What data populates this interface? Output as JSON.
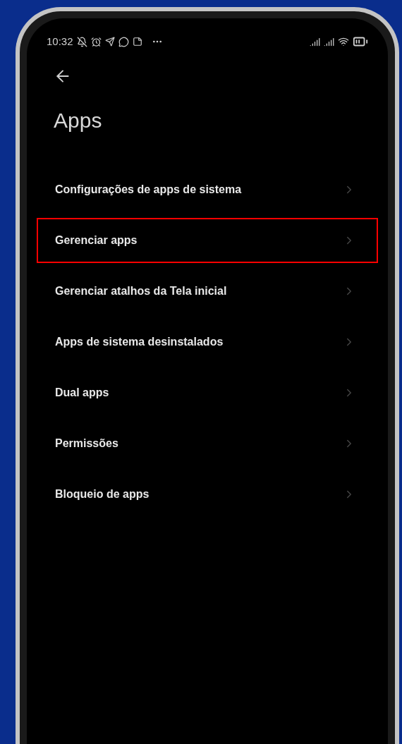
{
  "status_bar": {
    "time": "10:32"
  },
  "title": "Apps",
  "items": [
    {
      "label": "Configurações de apps de sistema",
      "highlighted": false
    },
    {
      "label": "Gerenciar apps",
      "highlighted": true
    },
    {
      "label": "Gerenciar atalhos da Tela inicial",
      "highlighted": false
    },
    {
      "label": "Apps de sistema desinstalados",
      "highlighted": false
    },
    {
      "label": "Dual apps",
      "highlighted": false
    },
    {
      "label": "Permissões",
      "highlighted": false
    },
    {
      "label": "Bloqueio de apps",
      "highlighted": false
    }
  ]
}
